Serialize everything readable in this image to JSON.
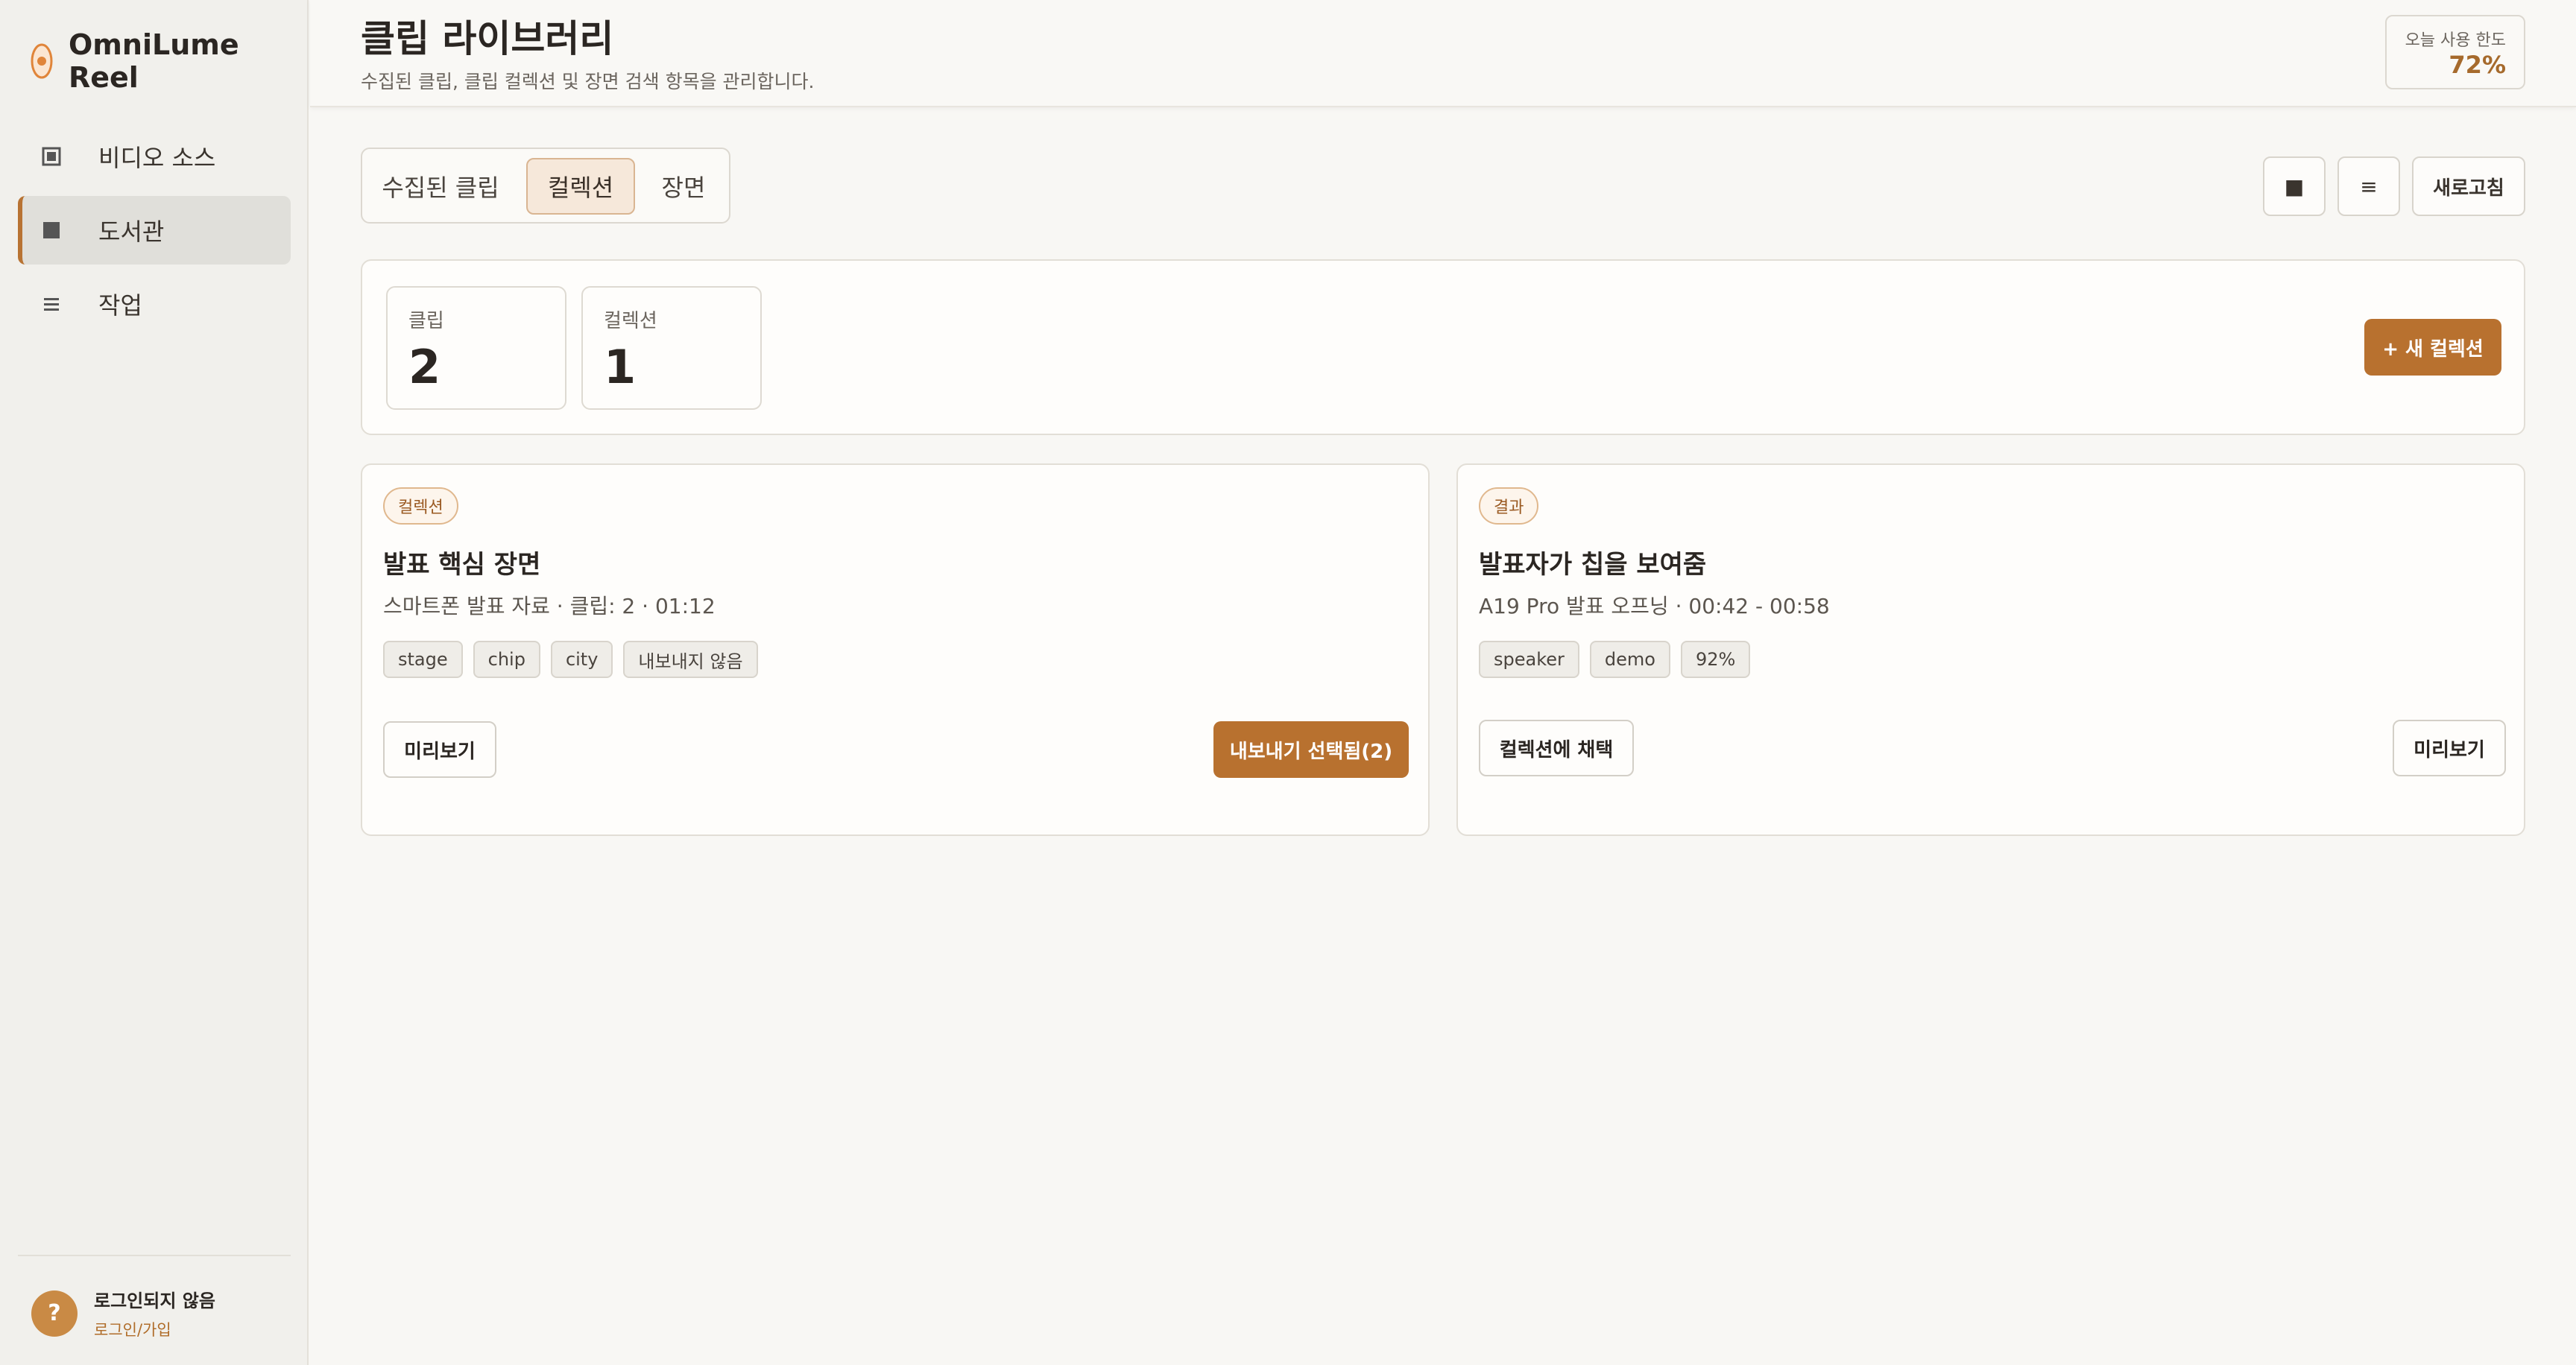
{
  "app": {
    "name": "OmniLume Reel",
    "accent_color": "#b8712f",
    "logo_icon": "flame-dot-icon"
  },
  "sidebar": {
    "items": [
      {
        "label": "비디오 소스",
        "icon": "square-frame-icon",
        "active": false
      },
      {
        "label": "도서관",
        "icon": "filled-square-icon",
        "active": true
      },
      {
        "label": "작업",
        "icon": "list-lines-icon",
        "active": false
      }
    ],
    "user": {
      "avatar_text": "?",
      "status": "로그인되지 않음",
      "login_link": "로그인/가입"
    }
  },
  "header": {
    "title": "클립 라이브러리",
    "subtitle": "수집된 클립, 클립 컬렉션 및 장면 검색 항목을 관리합니다.",
    "usage": {
      "label": "오늘 사용 한도",
      "value": "72%"
    }
  },
  "tabs": [
    {
      "label": "수집된 클립",
      "active": false
    },
    {
      "label": "컬렉션",
      "active": true
    },
    {
      "label": "장면",
      "active": false
    }
  ],
  "toolbar": {
    "grid_icon": "grid-view-icon",
    "list_icon": "list-view-icon",
    "grid_glyph": "■",
    "list_glyph": "≡",
    "refresh_label": "새로고침"
  },
  "stats": {
    "clips_label": "클립",
    "clips_value": "2",
    "collections_label": "컬렉션",
    "collections_value": "1",
    "new_collection_label": "+ 새 컬렉션"
  },
  "cards": [
    {
      "badge": "컬렉션",
      "title": "발표 핵심 장면",
      "meta": "스마트폰 발표 자료 · 클립: 2 · 01:12",
      "tags": [
        "stage",
        "chip",
        "city",
        "내보내지 않음"
      ],
      "left_button": "미리보기",
      "right_button": "내보내기 선택됨(2)"
    },
    {
      "badge": "결과",
      "title": "발표자가 칩을 보여줌",
      "meta": "A19 Pro 발표 오프닝 · 00:42 - 00:58",
      "tags": [
        "speaker",
        "demo",
        "92%"
      ],
      "left_button": "컬렉션에 채택",
      "right_button": "미리보기"
    }
  ]
}
